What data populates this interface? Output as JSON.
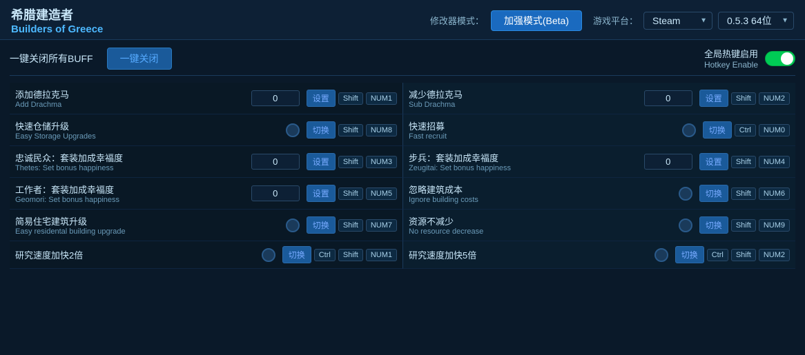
{
  "header": {
    "title_cn": "希腊建造者",
    "title_en": "Builders of Greece",
    "mode_label": "修改器模式：",
    "mode_btn": "加强模式(Beta)",
    "platform_label": "游戏平台：",
    "platform_value": "Steam",
    "version_value": "0.5.3 64位"
  },
  "toolbar": {
    "close_all_label": "一键关闭所有BUFF",
    "close_all_btn": "一键关闭",
    "hotkey_cn": "全局热键启用",
    "hotkey_en": "Hotkey Enable"
  },
  "cheats": [
    {
      "id": "add_drachma",
      "name_cn": "添加德拉克马",
      "name_en": "Add Drachma",
      "type": "input",
      "value": "0",
      "btn_label": "设置",
      "key1": "Shift",
      "key2": "NUM1"
    },
    {
      "id": "sub_drachma",
      "name_cn": "减少德拉克马",
      "name_en": "Sub Drachma",
      "type": "input",
      "value": "0",
      "btn_label": "设置",
      "key1": "Shift",
      "key2": "NUM2"
    },
    {
      "id": "easy_storage",
      "name_cn": "快速仓储升级",
      "name_en": "Easy Storage Upgrades",
      "type": "toggle",
      "btn_label": "切换",
      "key1": "Shift",
      "key2": "NUM8"
    },
    {
      "id": "fast_recruit",
      "name_cn": "快速招募",
      "name_en": "Fast recruit",
      "type": "toggle",
      "btn_label": "切换",
      "key1": "Ctrl",
      "key2": "NUM0"
    },
    {
      "id": "thetes_happiness",
      "name_cn": "忠诚民众：套装加成幸福度",
      "name_en": "Thetes: Set bonus happiness",
      "type": "input",
      "value": "0",
      "btn_label": "设置",
      "key1": "Shift",
      "key2": "NUM3"
    },
    {
      "id": "zeugitai_happiness",
      "name_cn": "步兵：套装加成幸福度",
      "name_en": "Zeugitai: Set bonus happiness",
      "type": "input",
      "value": "0",
      "btn_label": "设置",
      "key1": "Shift",
      "key2": "NUM4"
    },
    {
      "id": "geomori_happiness",
      "name_cn": "工作者：套装加成幸福度",
      "name_en": "Geomori: Set bonus happiness",
      "type": "input",
      "value": "0",
      "btn_label": "设置",
      "key1": "Shift",
      "key2": "NUM5"
    },
    {
      "id": "ignore_building_costs",
      "name_cn": "忽略建筑成本",
      "name_en": "Ignore building costs",
      "type": "toggle",
      "btn_label": "切换",
      "key1": "Shift",
      "key2": "NUM6"
    },
    {
      "id": "easy_residential",
      "name_cn": "简易住宅建筑升级",
      "name_en": "Easy residental building upgrade",
      "type": "toggle",
      "btn_label": "切换",
      "key1": "Shift",
      "key2": "NUM7"
    },
    {
      "id": "no_resource_decrease",
      "name_cn": "资源不减少",
      "name_en": "No resource decrease",
      "type": "toggle",
      "btn_label": "切换",
      "key1": "Shift",
      "key2": "NUM9"
    },
    {
      "id": "research_speed_2x",
      "name_cn": "研究速度加快2倍",
      "name_en": "",
      "type": "toggle",
      "btn_label": "切换",
      "key1": "Ctrl",
      "key2": "Shift",
      "key3": "NUM1"
    },
    {
      "id": "research_speed_5x",
      "name_cn": "研究速度加快5倍",
      "name_en": "",
      "type": "toggle",
      "btn_label": "切换",
      "key1": "Ctrl",
      "key2": "Shift",
      "key3": "NUM2"
    }
  ]
}
